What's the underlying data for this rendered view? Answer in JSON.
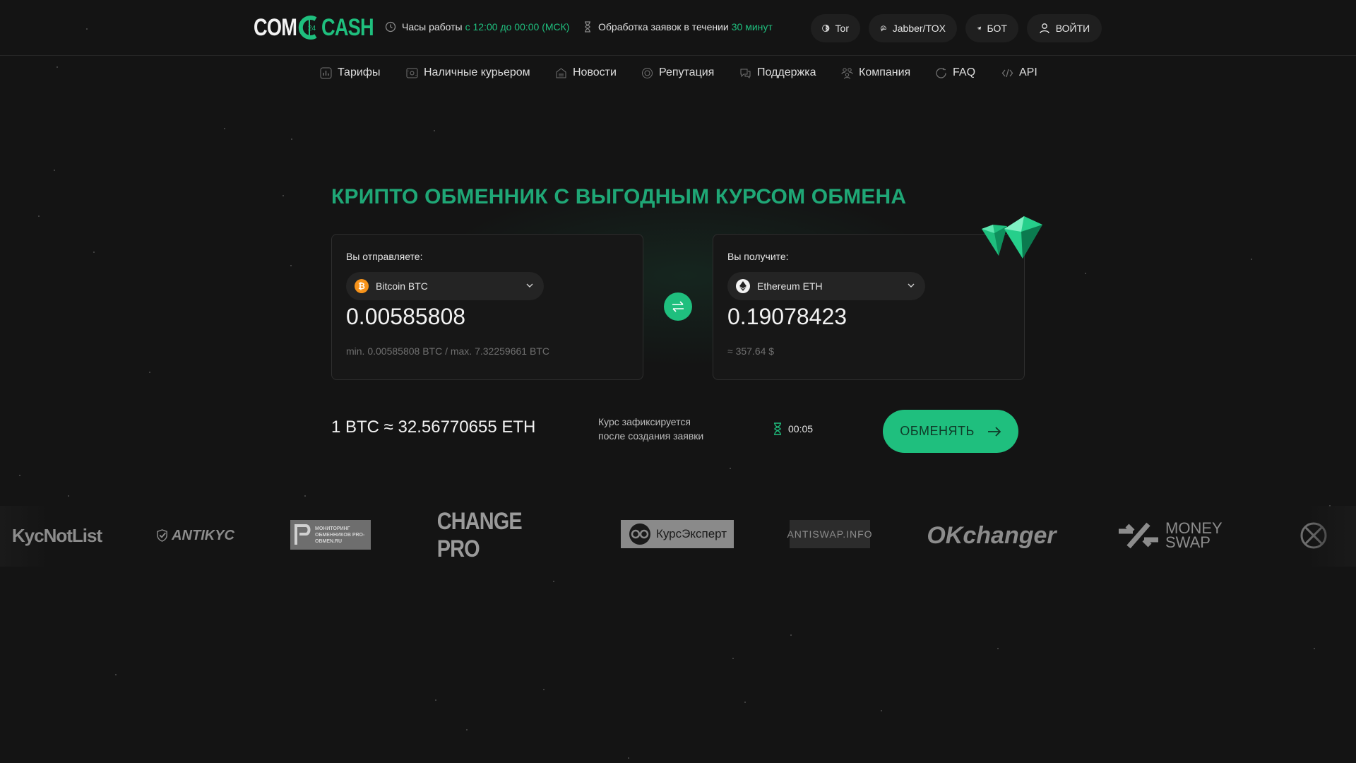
{
  "header": {
    "logo": {
      "left": "COM",
      "right": "CASH"
    },
    "hours": {
      "label": "Часы работы",
      "value": "с 12:00 до 00:00 (МСК)"
    },
    "processing": {
      "label": "Обработка заявок в течении",
      "value": "30 минут"
    },
    "buttons": {
      "tor": "Tor",
      "jabber": "Jabber/TOX",
      "bot": "БОТ",
      "login": "ВОЙТИ"
    }
  },
  "nav": {
    "items": [
      "Тарифы",
      "Наличные курьером",
      "Новости",
      "Репутация",
      "Поддержка",
      "Компания",
      "FAQ",
      "API"
    ]
  },
  "hero": {
    "title": "КРИПТО ОБМЕННИК С ВЫГОДНЫМ КУРСОМ ОБМЕНА"
  },
  "send": {
    "label": "Вы отправляете:",
    "currency": "Bitcoin BTC",
    "coin_symbol": "₿",
    "amount": "0.00585808",
    "limits": "min. 0.00585808 BTC / max. 7.32259661 BTC"
  },
  "receive": {
    "label": "Вы получите:",
    "currency": "Ethereum ETH",
    "amount": "0.19078423",
    "usd": "≈ 357.64 $"
  },
  "rate": {
    "text": "1 BTC ≈ 32.56770655 ETH",
    "fixed_line1": "Курс зафиксируется",
    "fixed_line2": "после создания заявки",
    "timer": "00:05"
  },
  "exchange_button": "ОБМЕНЯТЬ",
  "partners": [
    "KycNotList",
    "ANTIKYC",
    "МОНИТОРИНГ ОБМЕННИКОВ PRO-OBMEN.RU",
    "CHANGE PRO",
    "КурсЭксперт",
    "ANTISWAP.INFO",
    "OKchanger",
    "MONEY SWAP"
  ],
  "colors": {
    "accent": "#1fbf7e",
    "title": "#1fa776",
    "bg": "#141414",
    "btc": "#f7931a"
  }
}
